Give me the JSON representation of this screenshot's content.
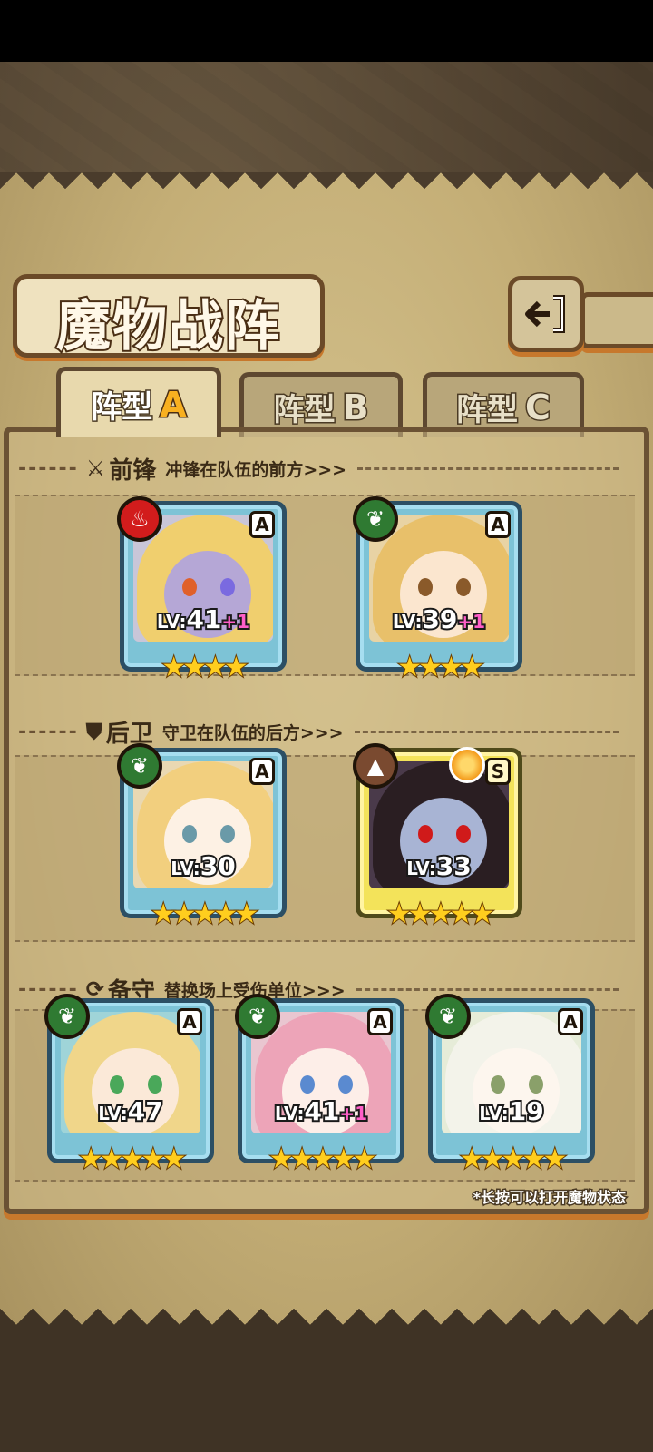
{
  "title": "魔物战阵",
  "tabs": [
    {
      "main": "阵型",
      "letter": "A",
      "active": true
    },
    {
      "main": "阵型",
      "letter": "B",
      "active": false
    },
    {
      "main": "阵型",
      "letter": "C",
      "active": false
    }
  ],
  "sections": {
    "front": {
      "title": "前锋",
      "desc": "冲锋在队伍的前方>>>",
      "icon": "sword-icon"
    },
    "back": {
      "title": "后卫",
      "desc": "守卫在队伍的后方>>>",
      "icon": "shield-icon"
    },
    "reserve": {
      "title": "备守",
      "desc": "替换场上受伤单位>>>",
      "icon": "swap-icon"
    }
  },
  "lv_prefix": "LV:",
  "monsters": {
    "front1": {
      "element": "fire-icon",
      "rank": "A",
      "level": "41",
      "bonus": "+1",
      "stars": 4
    },
    "front2": {
      "element": "leaf-icon",
      "rank": "A",
      "level": "39",
      "bonus": "+1",
      "stars": 4
    },
    "back1": {
      "element": "leaf-icon",
      "rank": "A",
      "level": "30",
      "bonus": "",
      "stars": 5
    },
    "back2": {
      "element": "rock-icon",
      "rank": "S",
      "level": "33",
      "bonus": "",
      "stars": 5
    },
    "res1": {
      "element": "leaf-icon",
      "rank": "A",
      "level": "47",
      "bonus": "",
      "stars": 5
    },
    "res2": {
      "element": "leaf-icon",
      "rank": "A",
      "level": "41",
      "bonus": "+1",
      "stars": 5
    },
    "res3": {
      "element": "leaf-icon",
      "rank": "A",
      "level": "19",
      "bonus": "",
      "stars": 5
    }
  },
  "stars_text": {
    "4": "★★★★",
    "5": "★★★★★"
  },
  "footnote": "*长按可以打开魔物状态",
  "colors": {
    "accent_gold": "#f8b020",
    "bonus_pink": "#ff5ec8",
    "frame_brown": "#6b5234"
  }
}
